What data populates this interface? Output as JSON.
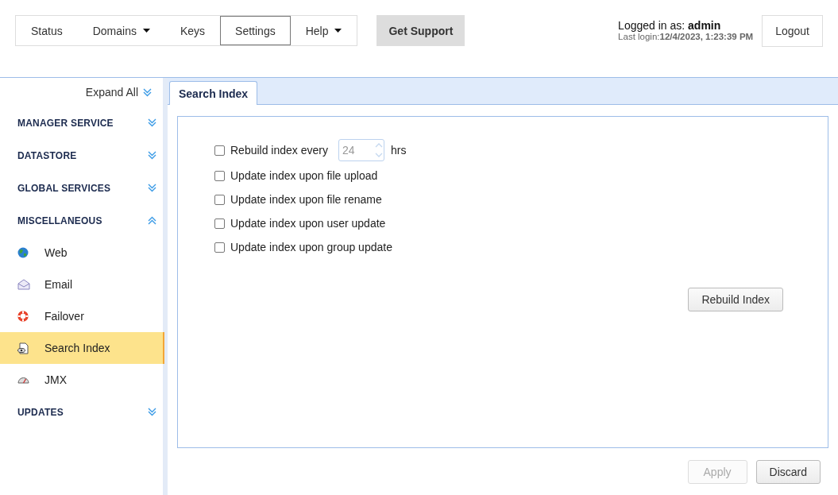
{
  "nav": {
    "items": [
      {
        "label": "Status",
        "kind": "link",
        "selected": false
      },
      {
        "label": "Domains",
        "kind": "dropdown",
        "selected": false
      },
      {
        "label": "Keys",
        "kind": "link",
        "selected": false
      },
      {
        "label": "Settings",
        "kind": "link",
        "selected": true
      },
      {
        "label": "Help",
        "kind": "dropdown",
        "selected": false
      }
    ],
    "support": "Get Support"
  },
  "user": {
    "label": "Logged in as:",
    "name": "admin",
    "last_login": "Last login:**12/4/2023, 1:23:39 PM**",
    "logout": "Logout"
  },
  "sidebar": {
    "expand_all": "Expand All",
    "sections": [
      {
        "title": "MANAGER SERVICE",
        "expanded": false
      },
      {
        "title": "DATASTORE",
        "expanded": false
      },
      {
        "title": "GLOBAL SERVICES",
        "expanded": false
      },
      {
        "title": "MISCELLANEOUS",
        "expanded": true,
        "items": [
          {
            "label": "Web",
            "kind": "web",
            "selected": false
          },
          {
            "label": "Email",
            "kind": "email",
            "selected": false
          },
          {
            "label": "Failover",
            "kind": "failover",
            "selected": false
          },
          {
            "label": "Search Index",
            "kind": "search",
            "selected": true
          },
          {
            "label": "JMX",
            "kind": "jmx",
            "selected": false
          }
        ]
      },
      {
        "title": "UPDATES",
        "expanded": false
      }
    ]
  },
  "tabs": [
    {
      "label": "Search Index",
      "selected": true
    }
  ],
  "options": [
    {
      "kind": "interval",
      "label": "Rebuild index every",
      "checked": false,
      "value": "24",
      "unit": "hrs",
      "disabled": true
    },
    {
      "kind": "checkbox",
      "label": "Update index upon file upload",
      "checked": false
    },
    {
      "kind": "checkbox",
      "label": "Update index upon file rename",
      "checked": false
    },
    {
      "kind": "checkbox",
      "label": "Update index upon user update",
      "checked": false
    },
    {
      "kind": "checkbox",
      "label": "Update index upon group update",
      "checked": false
    }
  ],
  "rebuild_button": "Rebuild Index",
  "footer_buttons": [
    {
      "label": "Apply",
      "disabled": true
    },
    {
      "label": "Discard",
      "disabled": false
    }
  ]
}
